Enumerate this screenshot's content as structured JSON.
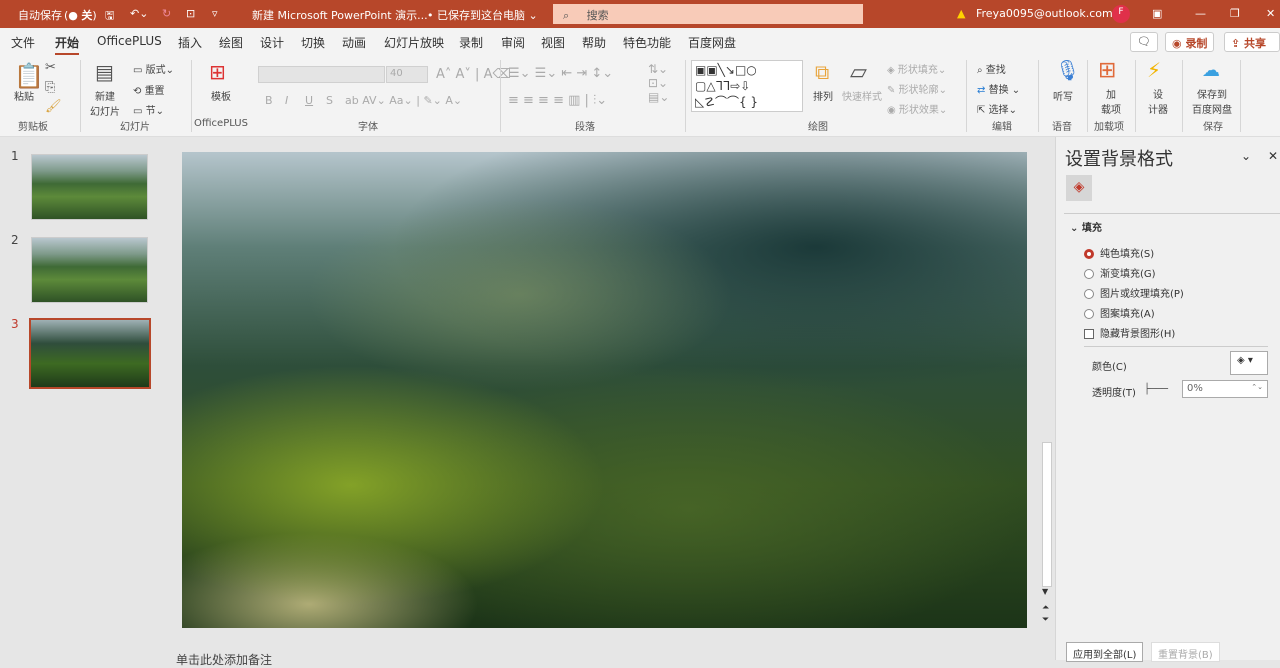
{
  "titlebar": {
    "autosave": "自动保存",
    "autosave_state": "关",
    "doc_title": "新建 Microsoft PowerPoint 演示...",
    "save_status": "• 已保存到这台电脑 ⌄",
    "search_placeholder": "搜索",
    "account": "Freya0095@outlook.com",
    "avatar": "F",
    "accent": "#b7472a"
  },
  "menu": {
    "tabs": [
      "文件",
      "开始",
      "OfficePLUS",
      "插入",
      "绘图",
      "设计",
      "切换",
      "动画",
      "幻灯片放映",
      "录制",
      "审阅",
      "视图",
      "帮助",
      "特色功能",
      "百度网盘"
    ],
    "active": "开始",
    "record_label": "录制",
    "share_label": "共享"
  },
  "ribbon": {
    "clipboard": {
      "paste": "粘贴",
      "group": "剪贴板"
    },
    "slides": {
      "new_slide": "新建\n幻灯片",
      "layout": "版式",
      "reset": "重置",
      "section": "节",
      "group": "幻灯片"
    },
    "officeplus": {
      "template": "模板",
      "group": "OfficePLUS"
    },
    "font": {
      "size": "40",
      "bold": "B",
      "italic": "I",
      "underline": "U",
      "strike": "S",
      "group": "字体"
    },
    "paragraph": {
      "group": "段落"
    },
    "drawing": {
      "arrange": "排列",
      "quick_styles": "快速样式",
      "shape_fill": "形状填充",
      "shape_outline": "形状轮廓",
      "shape_effects": "形状效果",
      "group": "绘图"
    },
    "editing": {
      "find": "查找",
      "replace": "替换",
      "select": "选择",
      "group": "编辑"
    },
    "voice": {
      "dictate": "听写",
      "group": "语音"
    },
    "addins": {
      "addins": "加\n载项",
      "group": "加载项"
    },
    "designer": {
      "label": "设\n计器"
    },
    "save": {
      "baidu": "保存到\n百度网盘",
      "group": "保存"
    }
  },
  "thumbnails": [
    {
      "number": "1"
    },
    {
      "number": "2"
    },
    {
      "number": "3",
      "selected": true
    }
  ],
  "notes_placeholder": "单击此处添加备注",
  "pane": {
    "title": "设置背景格式",
    "section": "填充",
    "options": [
      {
        "label": "纯色填充(S)",
        "selected": true
      },
      {
        "label": "渐变填充(G)",
        "selected": false
      },
      {
        "label": "图片或纹理填充(P)",
        "selected": false
      },
      {
        "label": "图案填充(A)",
        "selected": false
      }
    ],
    "hide_bg": "隐藏背景图形(H)",
    "color_label": "颜色(C)",
    "transparency_label": "透明度(T)",
    "transparency_value": "0%",
    "apply_all": "应用到全部(L)",
    "reset_bg": "重置背景(B)"
  }
}
